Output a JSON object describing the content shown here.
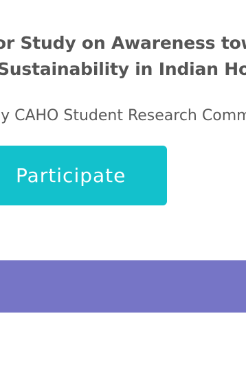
{
  "hero": {
    "title_line1": "For Study on Awareness towards",
    "title_line2": "Sustainability in Indian Hospitals",
    "subtitle": "By CAHO Student Research Committee",
    "participate_label": "Participate"
  },
  "colors": {
    "title_text": "#555555",
    "button_bg": "#13c1cc",
    "button_text": "#ffffff",
    "banner_bg": "#7675c6",
    "page_bg": "#ffffff"
  }
}
